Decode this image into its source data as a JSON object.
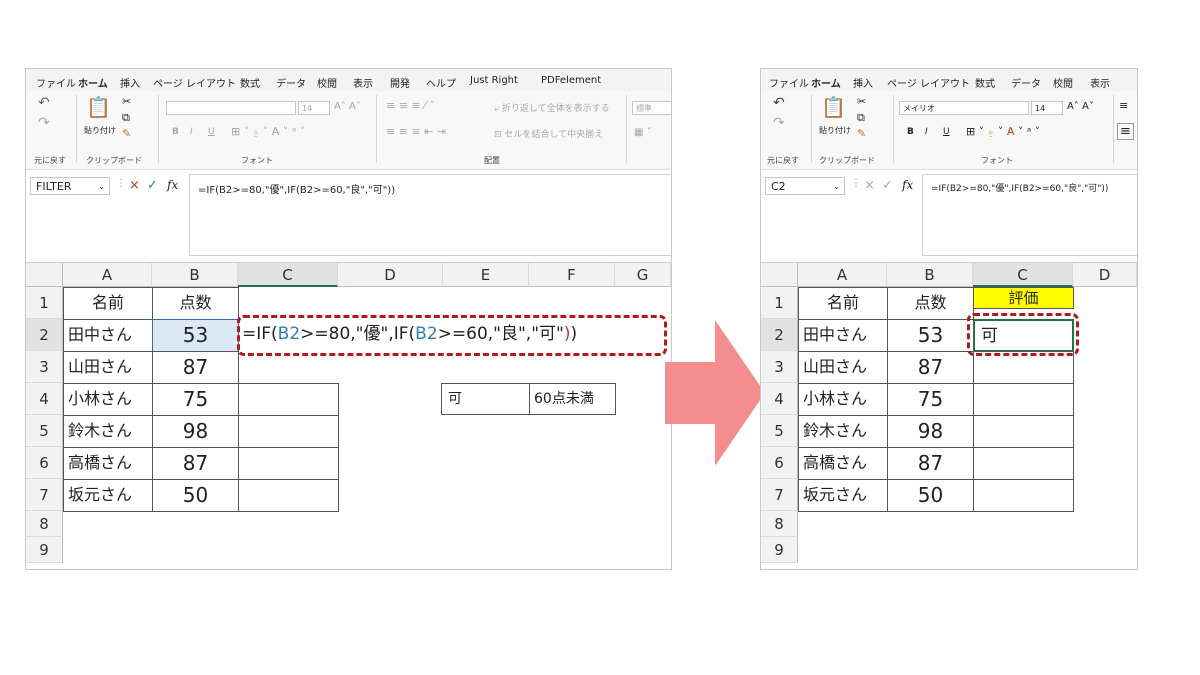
{
  "menu_tabs": [
    "ファイル",
    "ホーム",
    "挿入",
    "ページ レイアウト",
    "数式",
    "データ",
    "校閲",
    "表示",
    "開発",
    "ヘルプ",
    "Just Right",
    "PDFelement"
  ],
  "ribbon": {
    "undo_label": "元に戻す",
    "clipboard_label": "クリップボード",
    "paste_label": "貼り付け",
    "font_label": "フォント",
    "align_label": "配置",
    "wrap_text": "折り返して全体を表示する",
    "merge_center": "セルを結合して中央揃え",
    "number_format": "標準",
    "font_name_right": "メイリオ",
    "font_size": "14",
    "bold": "B",
    "italic": "I",
    "underline": "U"
  },
  "left": {
    "name_box": "FILTER",
    "formula_bar": "=IF(B2>=80,\"優\",IF(B2>=60,\"良\",\"可\"))",
    "col_headers": [
      "A",
      "B",
      "C",
      "D",
      "E",
      "F",
      "G"
    ],
    "row_headers": [
      "1",
      "2",
      "3",
      "4",
      "5",
      "6",
      "7",
      "8",
      "9"
    ],
    "header_name": "名前",
    "header_score": "点数",
    "names": [
      "田中さん",
      "山田さん",
      "小林さん",
      "鈴木さん",
      "高橋さん",
      "坂元さん"
    ],
    "scores": [
      "53",
      "87",
      "75",
      "98",
      "87",
      "50"
    ],
    "formula_parts": [
      "=IF(",
      "B2",
      ">=80,\"優\",IF(",
      "B2",
      ">=60,\"良\",\"可\"",
      ")",
      ")"
    ],
    "lookup_grade": "可",
    "lookup_desc": "60点未満"
  },
  "right": {
    "name_box": "C2",
    "formula_bar": "=IF(B2>=80,\"優\",IF(B2>=60,\"良\",\"可\"))",
    "col_headers": [
      "A",
      "B",
      "C",
      "D"
    ],
    "row_headers": [
      "1",
      "2",
      "3",
      "4",
      "5",
      "6",
      "7",
      "8",
      "9"
    ],
    "header_name": "名前",
    "header_score": "点数",
    "header_eval": "評価",
    "names": [
      "田中さん",
      "山田さん",
      "小林さん",
      "鈴木さん",
      "高橋さん",
      "坂元さん"
    ],
    "scores": [
      "53",
      "87",
      "75",
      "98",
      "87",
      "50"
    ],
    "result": "可"
  },
  "icons": {
    "cancel": "×",
    "confirm": "✓",
    "function": "fx"
  },
  "colors": {
    "dash_highlight": "#b01c1c",
    "arrow": "#f48d8d",
    "selected_fill": "#dbe8f6",
    "header_yellow": "#ffff00",
    "excel_green": "#217346",
    "cell_ref": "#2e7fb8"
  }
}
